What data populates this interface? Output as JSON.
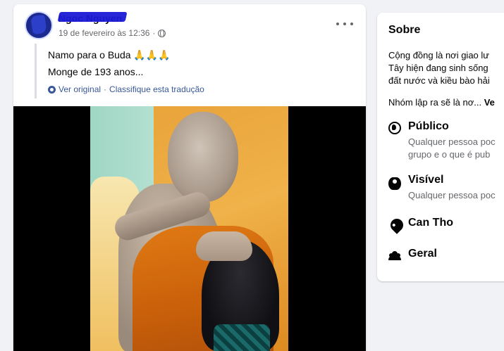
{
  "post": {
    "author": "Ngoc Nguyen",
    "timestamp": "19 de fevereiro às 12:36",
    "meta_sep": "·",
    "audience_icon": "globe-icon",
    "text_line1": "Namo para o Buda 🙏🙏🙏",
    "text_line2": "Monge de 193 anos...",
    "see_original": "Ver original",
    "translate_sep": "·",
    "rate_translation": "Classifique esta tradução"
  },
  "about": {
    "title": "Sobre",
    "desc_line1": "Cộng đồng là nơi giao lư",
    "desc_line2": "Tây hiện đang sinh sống",
    "desc_line3": "đất nước và kiều bào hải",
    "more_text": "Nhóm lập ra sẽ là nơ...",
    "see_more": "Ve",
    "items": [
      {
        "icon": "globe-icon",
        "label": "Público",
        "sub1": "Qualquer pessoa poc",
        "sub2": "grupo e o que é pub"
      },
      {
        "icon": "eye-icon",
        "label": "Visível",
        "sub1": "Qualquer pessoa poc"
      },
      {
        "icon": "location-pin-icon",
        "label": "Can Tho"
      },
      {
        "icon": "people-icon",
        "label": "Geral"
      }
    ]
  }
}
